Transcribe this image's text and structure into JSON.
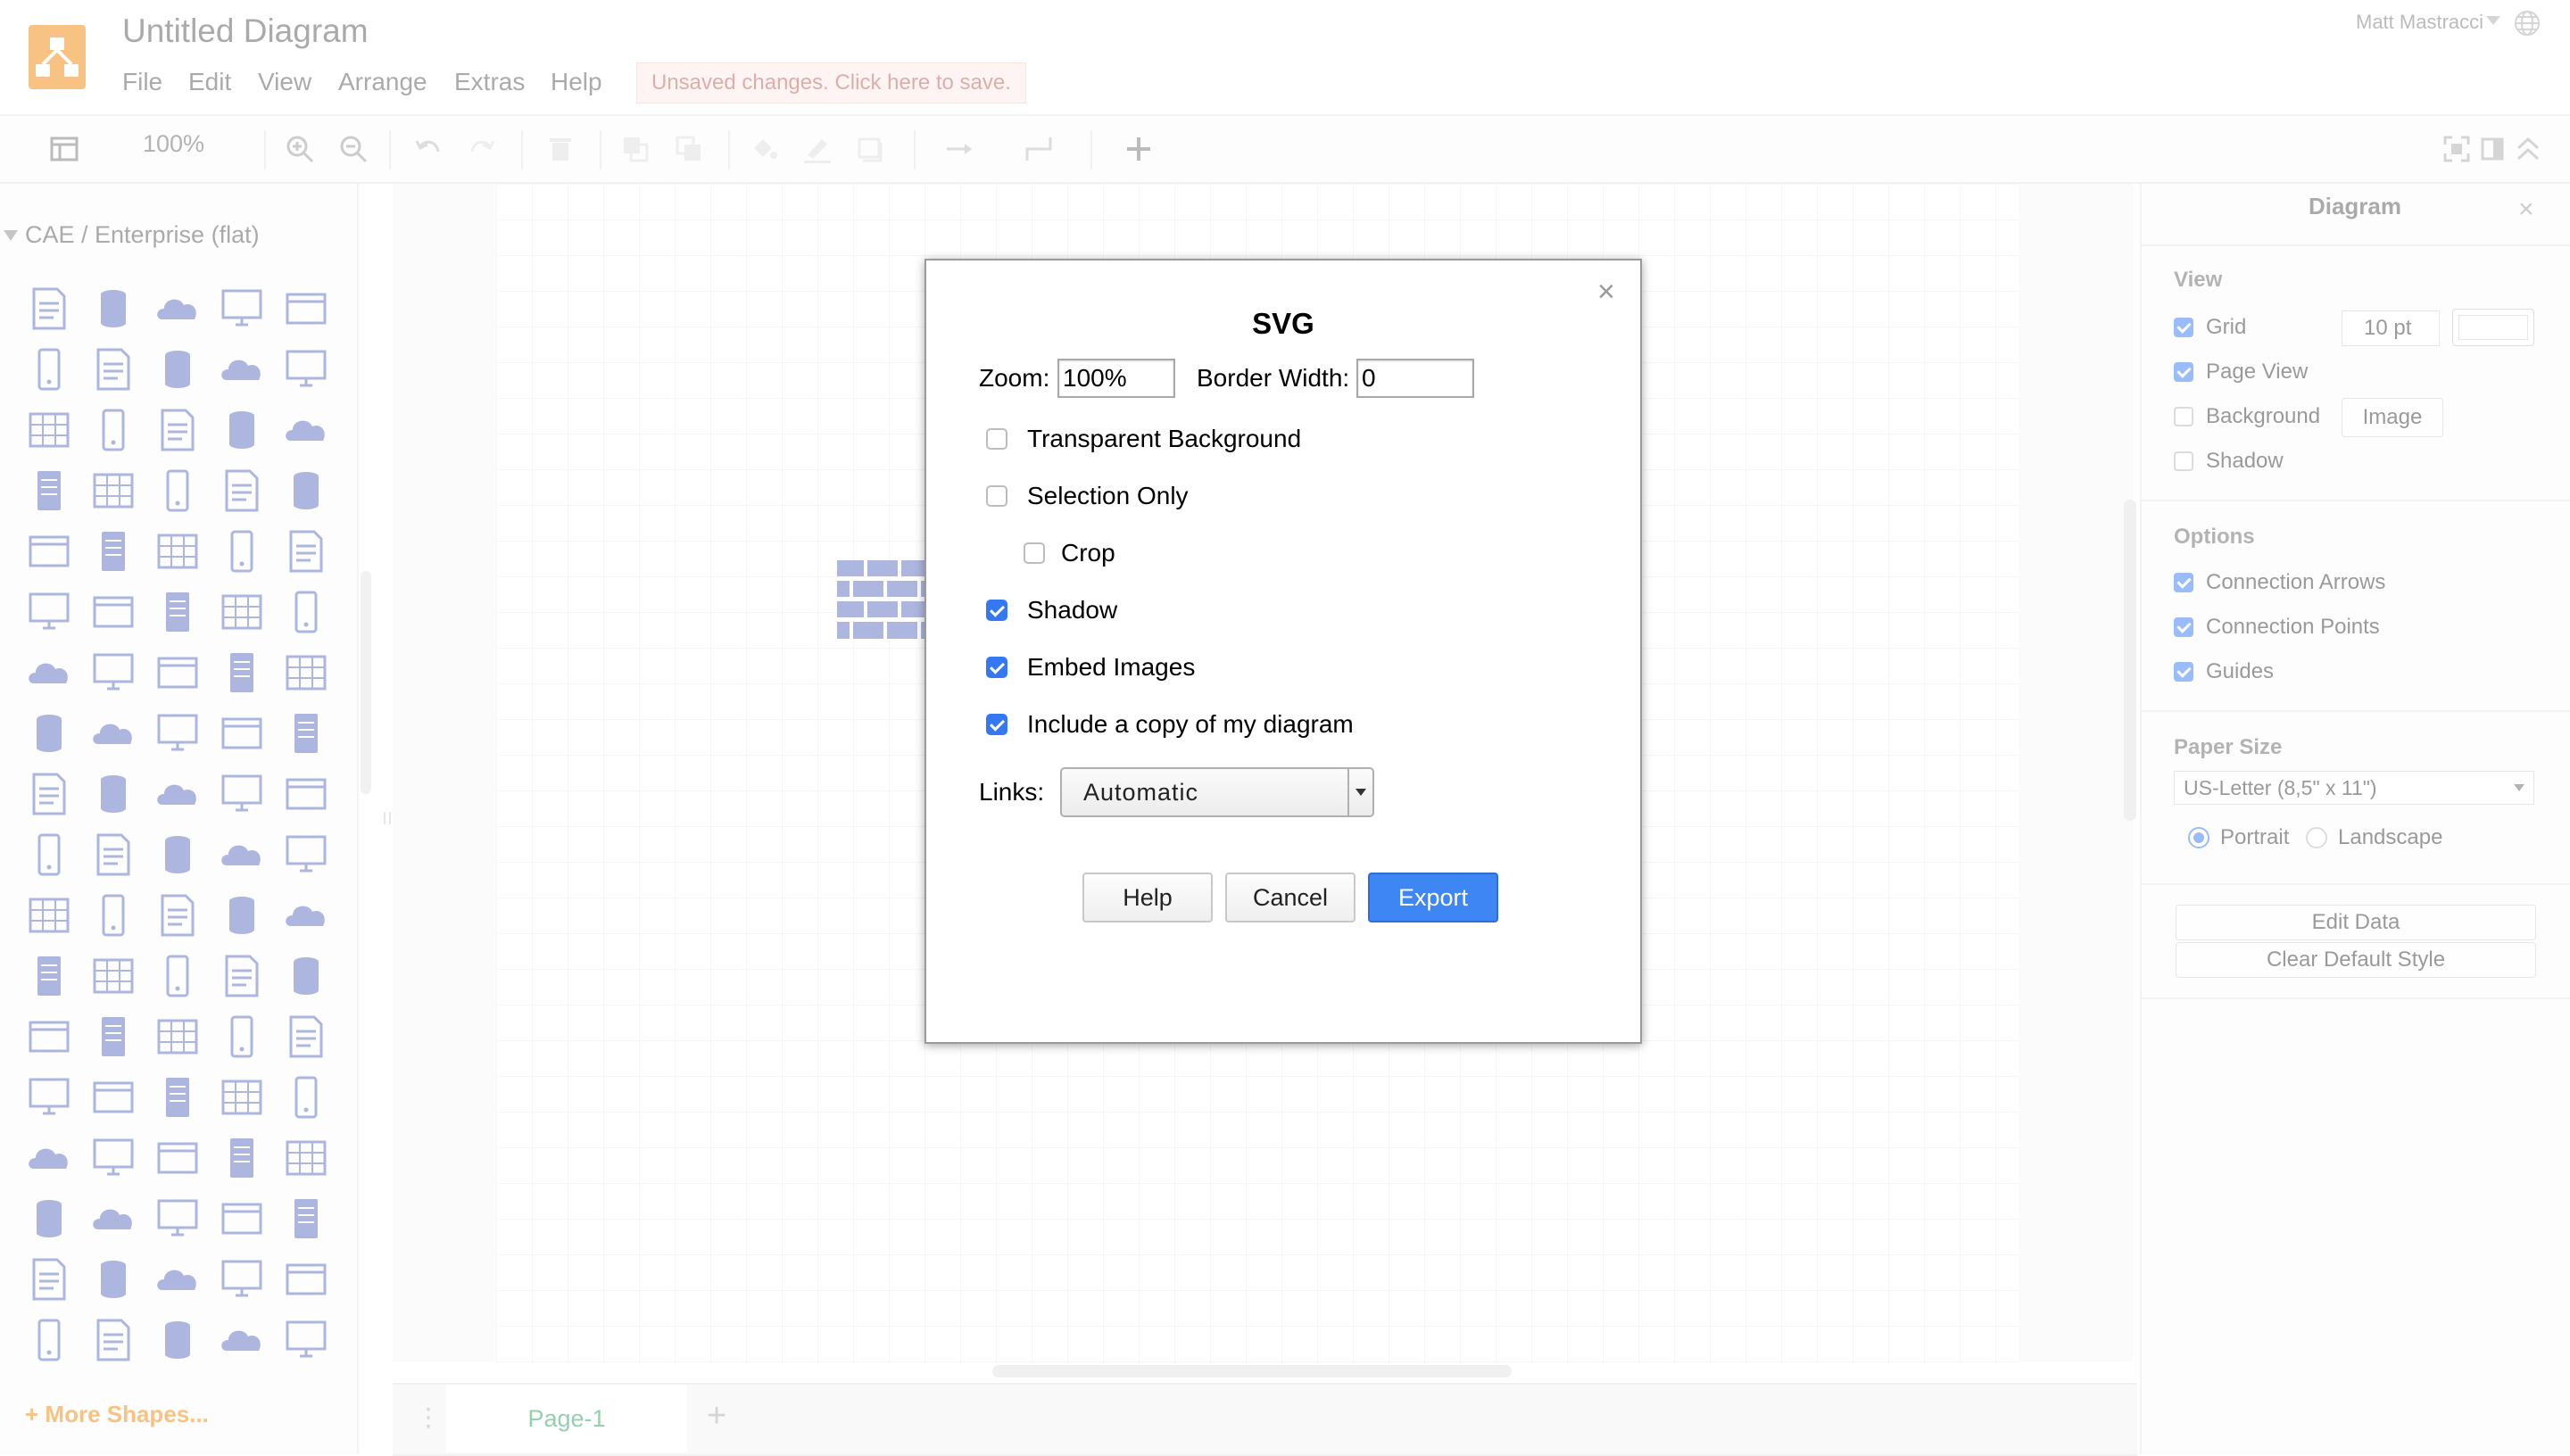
{
  "header": {
    "title": "Untitled Diagram",
    "menu": [
      "File",
      "Edit",
      "View",
      "Arrange",
      "Extras",
      "Help"
    ],
    "unsaved_notice": "Unsaved changes. Click here to save.",
    "user": "Matt Mastracci"
  },
  "toolbar": {
    "zoom": "100%"
  },
  "sidebar": {
    "library_title": "CAE / Enterprise (flat)",
    "more_shapes": "+ More Shapes..."
  },
  "pages": {
    "tab": "Page-1"
  },
  "format_panel": {
    "title": "Diagram",
    "view_section": "View",
    "grid": {
      "label": "Grid",
      "checked": true,
      "size": "10 pt"
    },
    "page_view": {
      "label": "Page View",
      "checked": true
    },
    "background": {
      "label": "Background",
      "checked": false,
      "button": "Image"
    },
    "shadow": {
      "label": "Shadow",
      "checked": false
    },
    "options_section": "Options",
    "connection_arrows": {
      "label": "Connection Arrows",
      "checked": true
    },
    "connection_points": {
      "label": "Connection Points",
      "checked": true
    },
    "guides": {
      "label": "Guides",
      "checked": true
    },
    "paper_size_section": "Paper Size",
    "paper_size": "US-Letter (8,5\" x 11\")",
    "portrait": "Portrait",
    "landscape": "Landscape",
    "edit_data": "Edit Data",
    "clear_default_style": "Clear Default Style"
  },
  "dialog": {
    "title": "SVG",
    "close": "×",
    "zoom_label": "Zoom:",
    "zoom_value": "100%",
    "border_label": "Border Width:",
    "border_value": "0",
    "transparent_background": {
      "label": "Transparent Background",
      "checked": false
    },
    "selection_only": {
      "label": "Selection Only",
      "checked": false
    },
    "crop": {
      "label": "Crop",
      "checked": false
    },
    "shadow": {
      "label": "Shadow",
      "checked": true
    },
    "embed_images": {
      "label": "Embed Images",
      "checked": true
    },
    "include_copy": {
      "label": "Include a copy of my diagram",
      "checked": true
    },
    "links_label": "Links:",
    "links_value": "Automatic",
    "help": "Help",
    "cancel": "Cancel",
    "export": "Export"
  },
  "colors": {
    "accent": "#3f86f5",
    "brand": "#f08705",
    "shape_icon": "#5b6cbf",
    "page_tab_text": "#26a05a"
  }
}
